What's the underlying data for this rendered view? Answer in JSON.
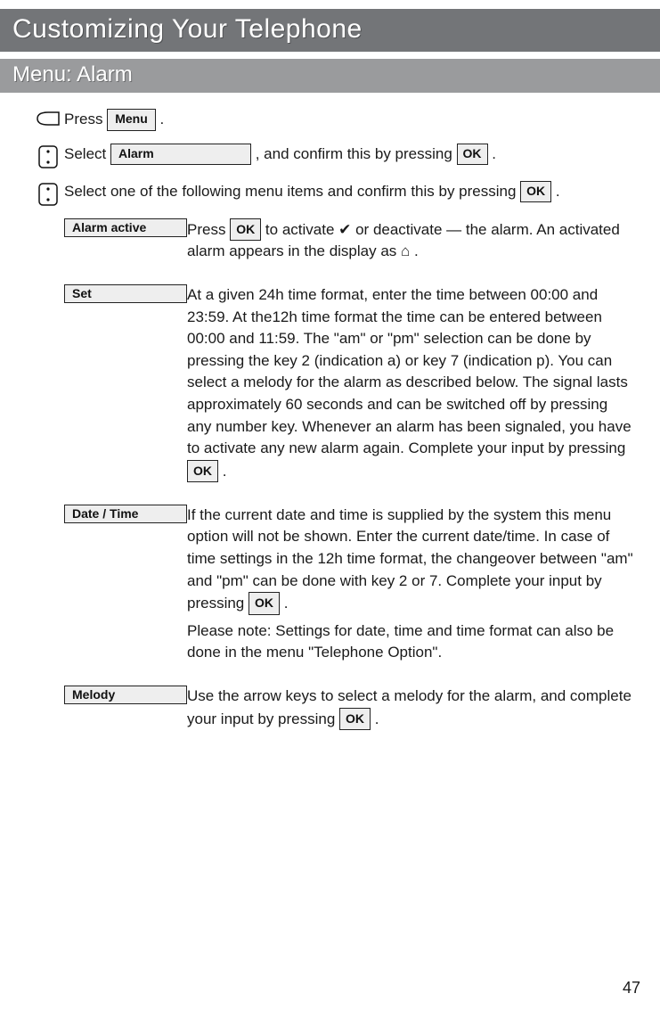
{
  "title": "Customizing Your Telephone",
  "section": "Menu: Alarm",
  "steps": {
    "s1_pre": "Press ",
    "s1_btn": "Menu",
    "s1_post": ".",
    "s2_pre": "Select ",
    "s2_btn": "Alarm",
    "s2_mid": " , and confirm this by pressing  ",
    "s2_ok": "OK",
    "s2_post": "  .",
    "s3_pre": "Select one of the following menu items and confirm this by pressing  ",
    "s3_ok": "OK",
    "s3_post": "  ."
  },
  "items": {
    "alarm_active": {
      "label": "Alarm active",
      "d_pre": "Press ",
      "d_ok": "OK",
      "d_mid": " to activate ✔ or deactivate — the alarm. An activated alarm appears in the display as ",
      "d_icon": "⌂",
      "d_post": " ."
    },
    "set": {
      "label": "Set",
      "d_pre": "At a given 24h time format, enter the time between 00:00 and 23:59. At the12h time format the time can be entered between 00:00 and 11:59. The \"am\" or \"pm\" selection can be done by pressing the key 2 (indication a) or key 7 (indication p). You can select a melody for the alarm as described below. The signal lasts approximately 60 seconds and can be switched off by pressing any number key. Whenever an alarm has been signaled, you have to activate any new alarm again. Complete your input by pressing ",
      "d_ok": "OK",
      "d_post": " ."
    },
    "date": {
      "label": "Date / Time",
      "d_pre": "If the current date and time is supplied by the system this menu option will not be shown. Enter the current date/time. In case of time settings in the 12h time format, the changeover between \"am\" and \"pm\" can be done with key 2 or 7. Complete your input by pressing ",
      "d_ok": "OK",
      "d_post": ".",
      "note": "Please note: Settings for date, time and time format can also be done in the menu \"Telephone Option\"."
    },
    "melody": {
      "label": "Melody",
      "d_pre": "Use the arrow keys to select a melody for the alarm, and complete your input by pressing ",
      "d_ok": "OK",
      "d_post": " ."
    }
  },
  "page_number": "47"
}
